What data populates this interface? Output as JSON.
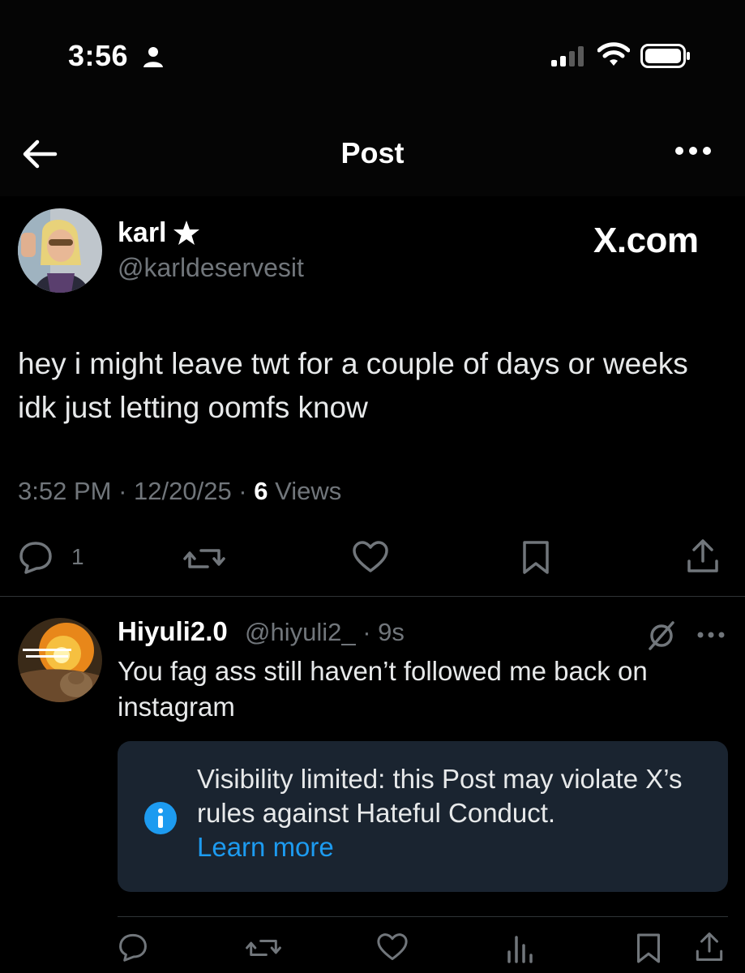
{
  "status_bar": {
    "time": "3:56"
  },
  "header": {
    "title": "Post"
  },
  "post": {
    "author_name": "karl",
    "author_handle": "@karldeservesit",
    "brand": "X.com",
    "text": "hey i might leave twt for a couple of days or weeks idk just letting oomfs know",
    "time": "3:52 PM",
    "date": "12/20/25",
    "views_count": "6",
    "views_label": "Views",
    "reply_count": "1"
  },
  "reply": {
    "author_name": "Hiyuli2.0",
    "author_handle": "@hiyuli2_",
    "time": "9s",
    "text": "You fag ass still haven’t followed me back on instagram",
    "notice": {
      "text": "Visibility limited: this Post may violate X’s rules against Hateful Conduct.",
      "link_label": "Learn more"
    }
  },
  "colors": {
    "background": "#000000",
    "accent": "#1d9bf0",
    "muted": "#71767b",
    "notice_bg": "#1a2430"
  }
}
